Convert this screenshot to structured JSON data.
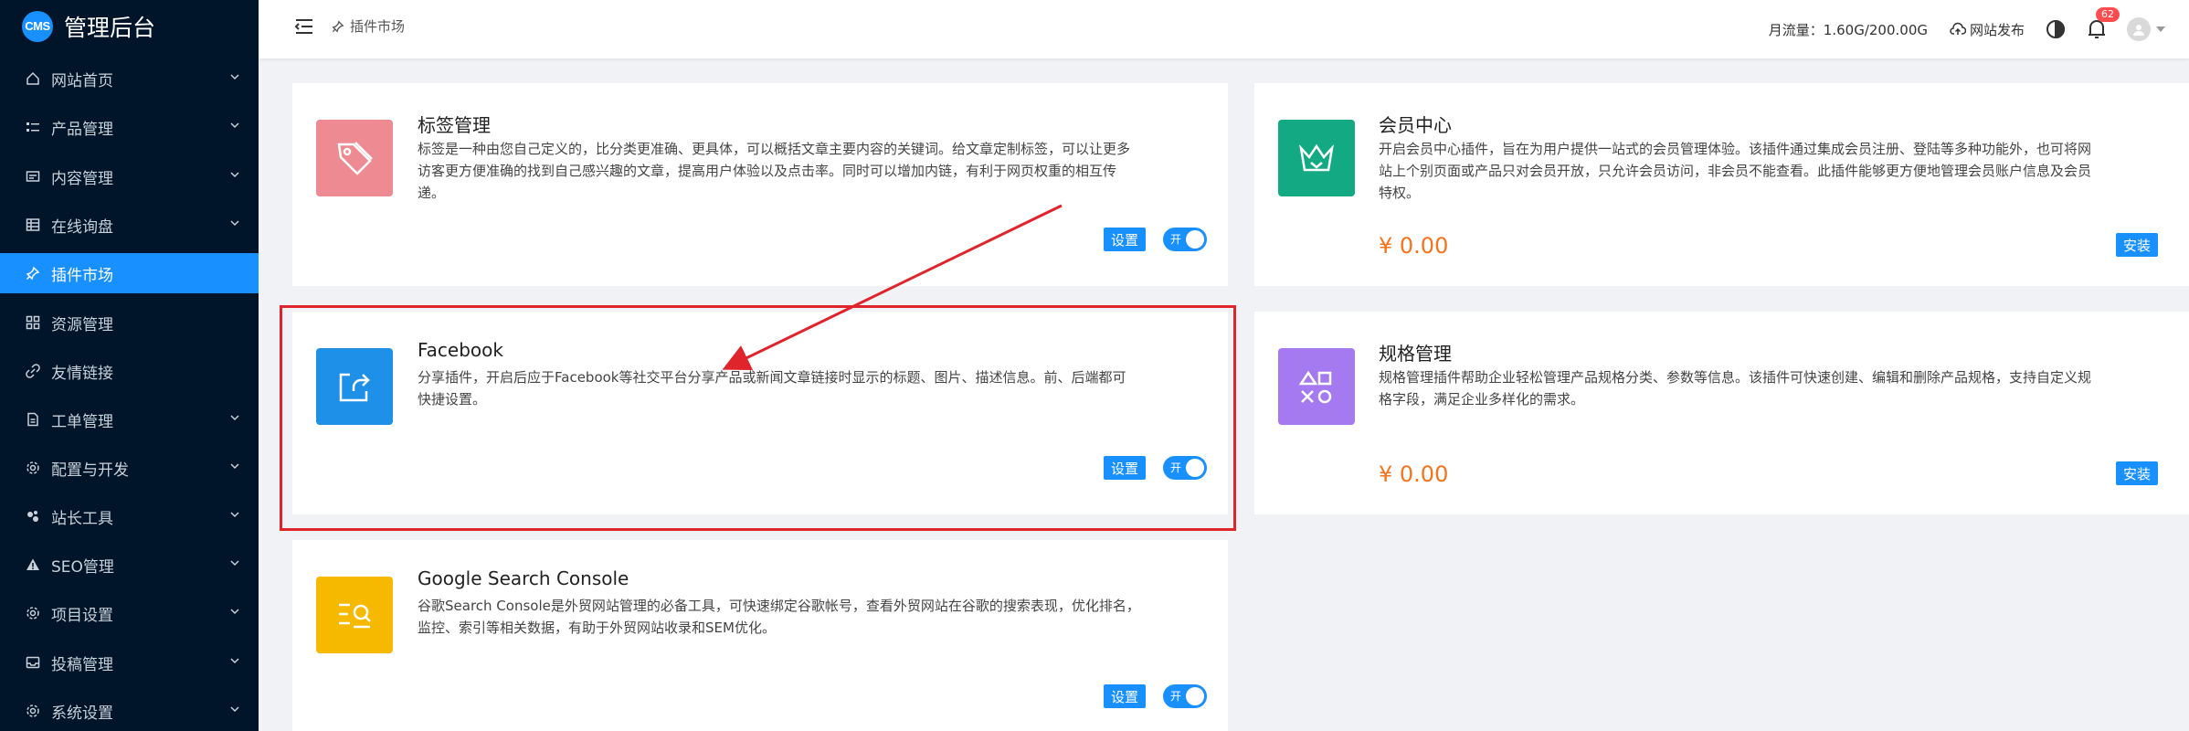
{
  "brand": {
    "logo": "CMS",
    "title": "管理后台"
  },
  "sidebar": {
    "items": [
      {
        "label": "网站首页",
        "icon": "home-icon"
      },
      {
        "label": "产品管理",
        "icon": "list-icon"
      },
      {
        "label": "内容管理",
        "icon": "document-icon"
      },
      {
        "label": "在线询盘",
        "icon": "grid-icon"
      },
      {
        "label": "插件市场",
        "icon": "pin-icon",
        "active": true
      },
      {
        "label": "资源管理",
        "icon": "apps-icon"
      },
      {
        "label": "友情链接",
        "icon": "link-icon"
      },
      {
        "label": "工单管理",
        "icon": "file-icon"
      },
      {
        "label": "配置与开发",
        "icon": "gear-icon"
      },
      {
        "label": "站长工具",
        "icon": "tools-icon"
      },
      {
        "label": "SEO管理",
        "icon": "warning-icon"
      },
      {
        "label": "项目设置",
        "icon": "settings-icon"
      },
      {
        "label": "投稿管理",
        "icon": "inbox-icon"
      },
      {
        "label": "系统设置",
        "icon": "cog-icon"
      }
    ]
  },
  "header": {
    "breadcrumb": "插件市场",
    "traffic": "月流量：1.60G/200.00G",
    "publish": "网站发布",
    "notification_count": "62"
  },
  "plugins": [
    {
      "title": "标签管理",
      "icon": "tag-icon",
      "color": "#ee8a92",
      "desc_lines": [
        "标签是一种由您自己定义的，比分类更准确、更具体，可以概括文章主要内容的关键词。给文章定制标签，可以让更多",
        "访客更方便准确的找到自己感兴趣的文章，提高用户体验以及点击率。同时可以增加内链，有利于网页权重的相互传",
        "递。"
      ],
      "settings": "设置",
      "toggle": "开"
    },
    {
      "title": "会员中心",
      "icon": "crown-icon",
      "color": "#13a982",
      "desc_lines": [
        "开启会员中心插件，旨在为用户提供一站式的会员管理体验。该插件通过集成会员注册、登陆等多种功能外，也可将网",
        "站上个别页面或产品只对会员开放，只允许会员访问，非会员不能查看。此插件能够更方便地管理会员账户信息及会员",
        "特权。"
      ],
      "price": "¥ 0.00",
      "install": "安装"
    },
    {
      "title": "Facebook",
      "icon": "share-icon",
      "color": "#1e90e8",
      "desc_lines": [
        "分享插件，开启后应于Facebook等社交平台分享产品或新闻文章链接时显示的标题、图片、描述信息。前、后端都可",
        "快捷设置。"
      ],
      "settings": "设置",
      "toggle": "开"
    },
    {
      "title": "规格管理",
      "icon": "shapes-icon",
      "color": "#a57af0",
      "desc_lines": [
        "规格管理插件帮助企业轻松管理产品规格分类、参数等信息。该插件可快速创建、编辑和删除产品规格，支持自定义规",
        "格字段，满足企业多样化的需求。"
      ],
      "price": "¥ 0.00",
      "install": "安装"
    },
    {
      "title": "Google Search Console",
      "icon": "search-console-icon",
      "color": "#f7b900",
      "desc_lines": [
        "谷歌Search Console是外贸网站管理的必备工具，可快速绑定谷歌帐号，查看外贸网站在谷歌的搜索表现，优化排名，",
        "监控、索引等相关数据，有助于外贸网站收录和SEM优化。"
      ],
      "settings": "设置",
      "toggle": "开"
    }
  ],
  "colors": {
    "accent": "#1890ff",
    "sidebar_bg": "#001529",
    "annotation_red": "#e0242c",
    "price": "#f5731c"
  }
}
